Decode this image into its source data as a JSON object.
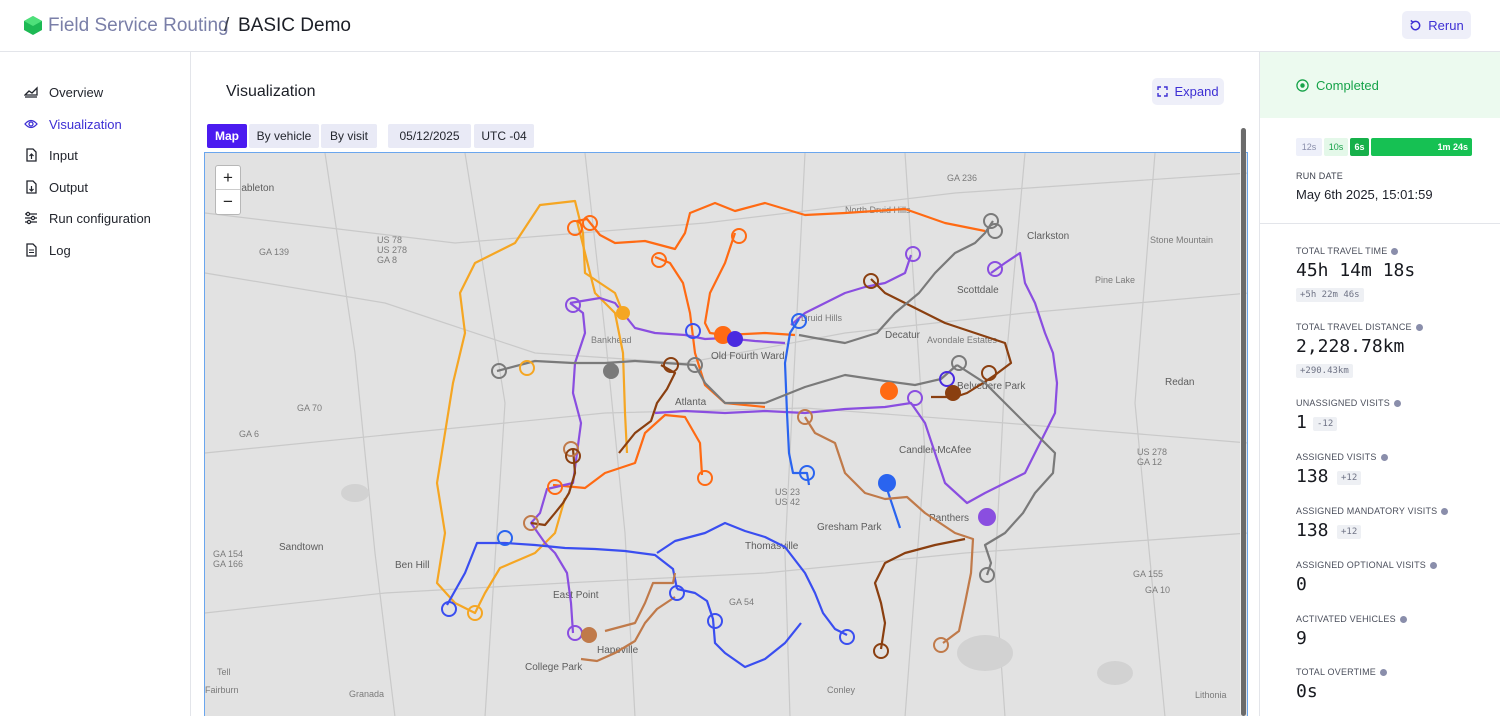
{
  "header": {
    "app_name": "Field Service Routing",
    "separator": "/",
    "page_name": "BASIC Demo",
    "rerun_label": "Rerun",
    "brand_color": "#1db954",
    "accent_color": "#4b1bf0"
  },
  "sidebar": {
    "items": [
      {
        "label": "Overview",
        "icon": "chart-area-icon",
        "active": false
      },
      {
        "label": "Visualization",
        "icon": "eye-icon",
        "active": true
      },
      {
        "label": "Input",
        "icon": "file-upload-icon",
        "active": false
      },
      {
        "label": "Output",
        "icon": "file-download-icon",
        "active": false
      },
      {
        "label": "Run configuration",
        "icon": "sliders-icon",
        "active": false
      },
      {
        "label": "Log",
        "icon": "file-text-icon",
        "active": false
      }
    ]
  },
  "main": {
    "title": "Visualization",
    "expand_label": "Expand",
    "tabs": [
      {
        "label": "Map",
        "active": true
      },
      {
        "label": "By vehicle",
        "active": false
      },
      {
        "label": "By visit",
        "active": false
      }
    ],
    "date": "05/12/2025",
    "timezone": "UTC -04",
    "zoom_in": "+",
    "zoom_out": "−"
  },
  "map": {
    "place_labels": [
      "Mableton",
      "Clarkston",
      "Stone Mountain",
      "Scottdale",
      "Pine Lake",
      "Decatur",
      "Avondale Estates",
      "Belvedere Park",
      "Redan",
      "Candler-McAfee",
      "Panthers",
      "Gresham Park",
      "Thomasville",
      "East Point",
      "Hapeville",
      "College Park",
      "Ben Hill",
      "Sandtown",
      "Granada",
      "Tell",
      "Fairburn",
      "Conley",
      "Old Fourth Ward",
      "Atlanta",
      "North Druid Hills",
      "Druid Hills",
      "Bankhead",
      "Lithonia"
    ],
    "road_labels": [
      "GA 236",
      "US 78",
      "US 278",
      "GA 8",
      "GA 139",
      "GA 70",
      "GA 6",
      "GA 154",
      "GA 166",
      "GA 54",
      "US 23",
      "US 42",
      "GA 155",
      "US 278",
      "GA 12",
      "GA 10"
    ],
    "route_colors": [
      "#f5a623",
      "#ff6a13",
      "#8a4ee0",
      "#3a4ef0",
      "#2a64ef",
      "#8a3f10",
      "#c07a4a",
      "#7a7a7a",
      "#4a2ae0"
    ]
  },
  "panel": {
    "status": "Completed",
    "status_color": "#17a34a",
    "timeline": [
      "12s",
      "10s",
      "6s",
      "1m 24s"
    ],
    "run_date_label": "RUN DATE",
    "run_date_value": "May 6th 2025, 15:01:59",
    "metrics": [
      {
        "label": "TOTAL TRAVEL TIME",
        "value": "45h 14m 18s",
        "delta": "+5h 22m 46s"
      },
      {
        "label": "TOTAL TRAVEL DISTANCE",
        "value": "2,228.78km",
        "delta": "+290.43km"
      },
      {
        "label": "UNASSIGNED VISITS",
        "value": "1",
        "delta": "-12"
      },
      {
        "label": "ASSIGNED VISITS",
        "value": "138",
        "delta": "+12"
      },
      {
        "label": "ASSIGNED MANDATORY VISITS",
        "value": "138",
        "delta": "+12"
      },
      {
        "label": "ASSIGNED OPTIONAL VISITS",
        "value": "0",
        "delta": ""
      },
      {
        "label": "ACTIVATED VEHICLES",
        "value": "9",
        "delta": ""
      },
      {
        "label": "TOTAL OVERTIME",
        "value": "0s",
        "delta": ""
      }
    ]
  }
}
